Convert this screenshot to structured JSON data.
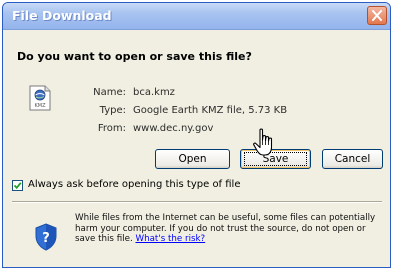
{
  "window": {
    "title": "File Download",
    "close_icon": "close-x-icon"
  },
  "dialog": {
    "question": "Do you want to open or save this file?",
    "file_icon": "kmz-file-icon",
    "file_icon_label": "KMZ",
    "info": {
      "name_label": "Name:",
      "name_value": "bca.kmz",
      "type_label": "Type:",
      "type_value": "Google Earth KMZ file, 5.73 KB",
      "from_label": "From:",
      "from_value": "www.dec.ny.gov"
    },
    "buttons": {
      "open": "Open",
      "save": "Save",
      "cancel": "Cancel"
    },
    "always_ask": {
      "checked": true,
      "label": "Always ask before opening this type of file"
    },
    "warning": {
      "icon": "shield-question-icon",
      "text": "While files from the Internet can be useful, some files can potentially harm your computer. If you do not trust the source, do not open or save this file.",
      "link": "What's the risk?"
    },
    "cursor_icon": "hand-pointer-icon"
  },
  "colors": {
    "title_gradient_top": "#c9daf7",
    "title_gradient_bottom": "#94b4ec",
    "close_button": "#e3774f",
    "dialog_bg": "#f1efe2",
    "button_border": "#003c74",
    "link": "#0000ff"
  }
}
